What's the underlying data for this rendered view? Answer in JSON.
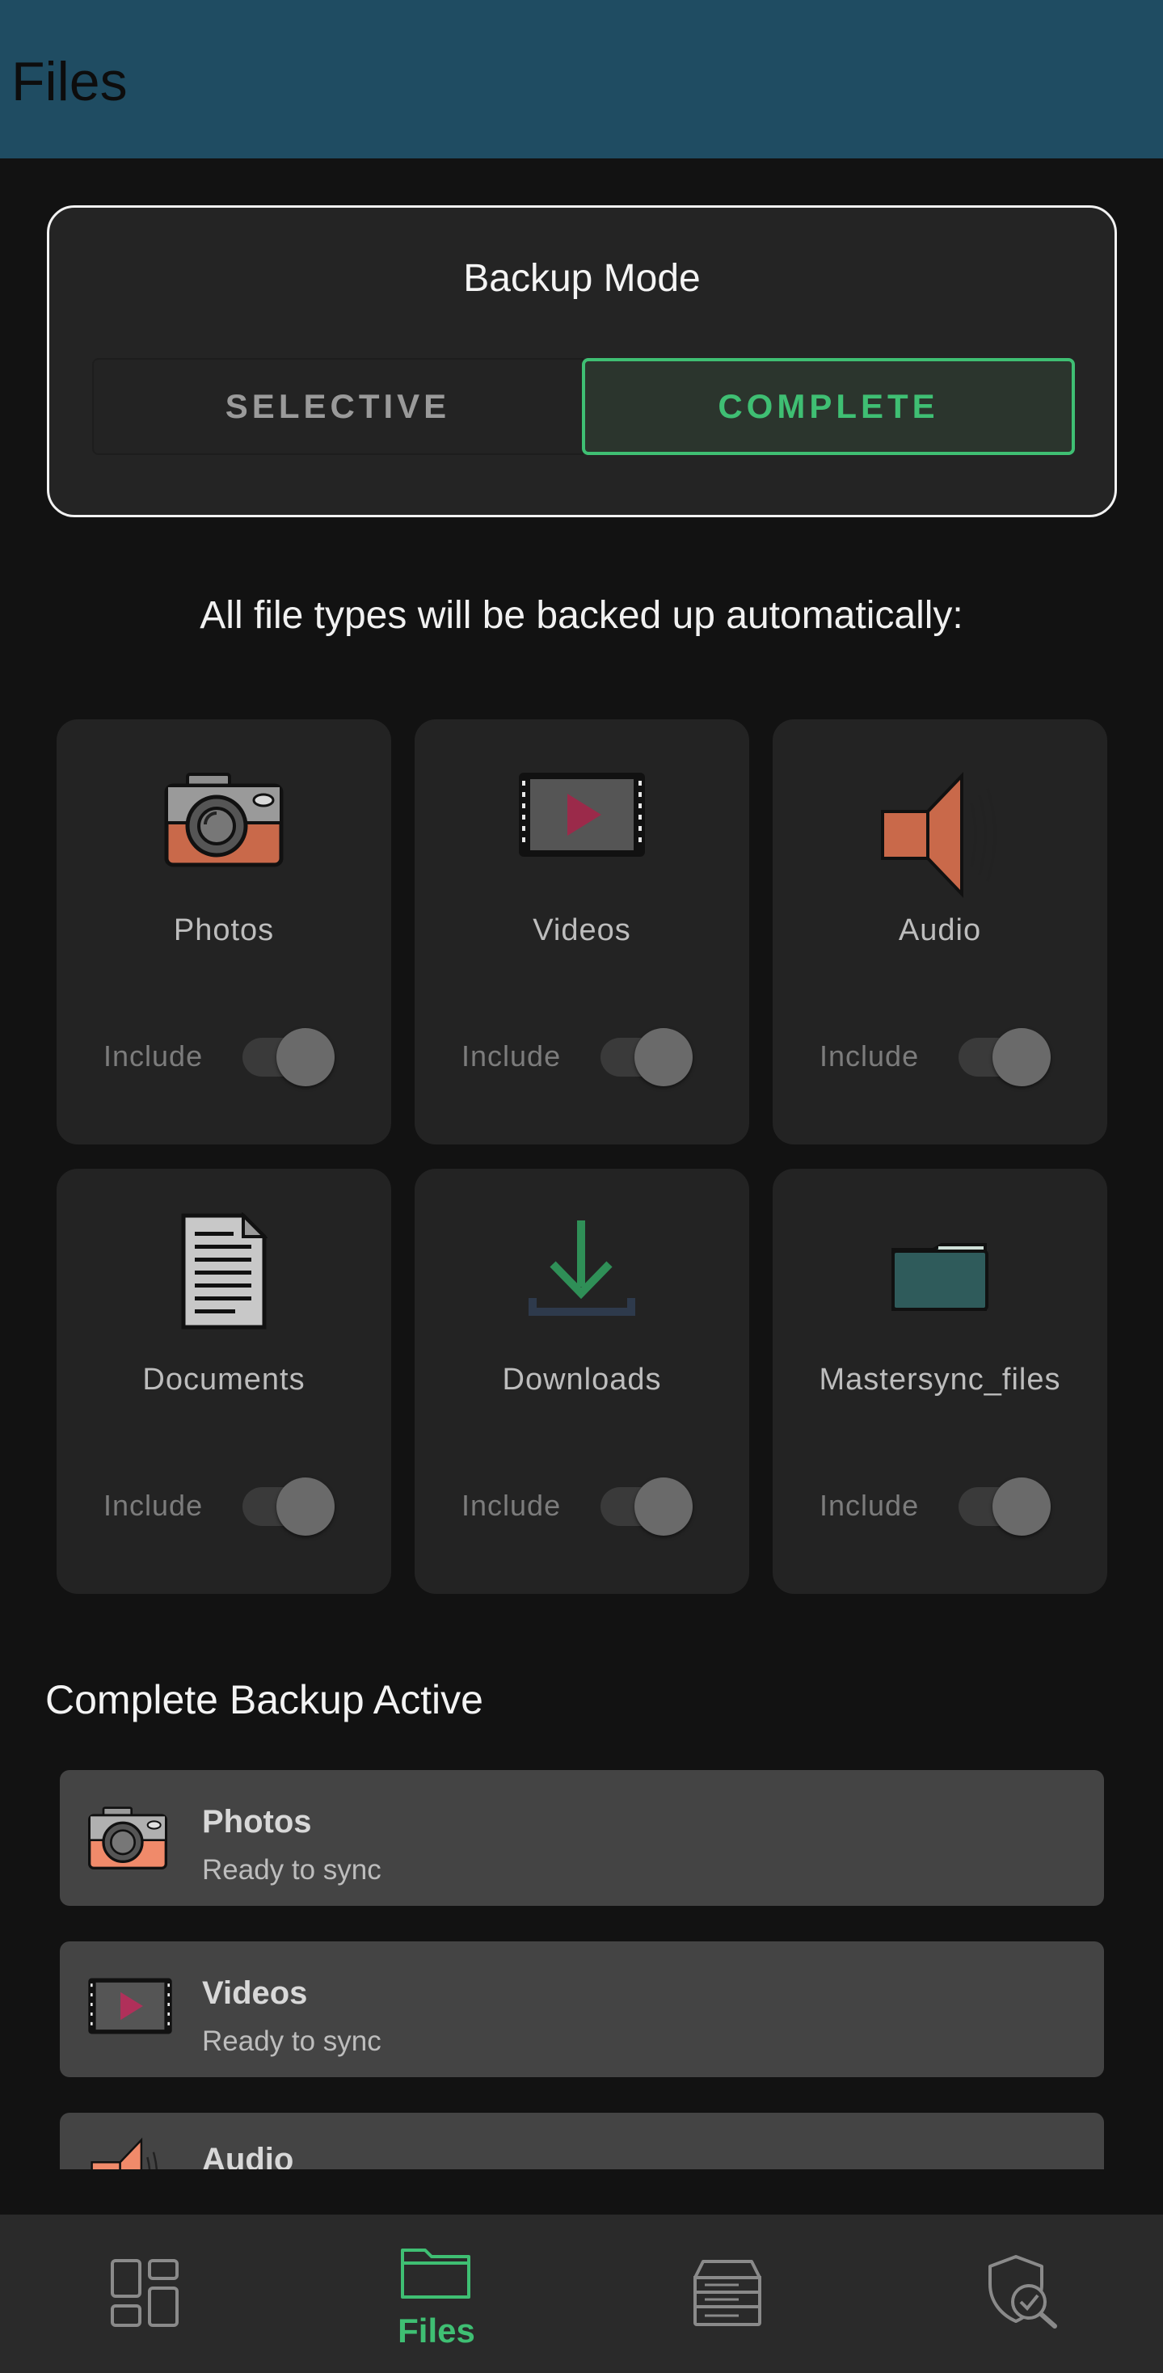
{
  "appbar": {
    "title": "Files",
    "color": "#1f4c62"
  },
  "backup_mode": {
    "title": "Backup Mode",
    "options": [
      {
        "label": "SELECTIVE",
        "selected": false
      },
      {
        "label": "COMPLETE",
        "selected": true
      }
    ],
    "accent": "#3fbf73"
  },
  "info_text": "All file types will be backed up automatically:",
  "file_types": [
    {
      "label": "Photos",
      "icon": "camera-icon",
      "toggle_label": "Include",
      "included": false
    },
    {
      "label": "Videos",
      "icon": "film-play-icon",
      "toggle_label": "Include",
      "included": false
    },
    {
      "label": "Audio",
      "icon": "speaker-icon",
      "toggle_label": "Include",
      "included": false
    },
    {
      "label": "Documents",
      "icon": "document-icon",
      "toggle_label": "Include",
      "included": false
    },
    {
      "label": "Downloads",
      "icon": "download-icon",
      "toggle_label": "Include",
      "included": false
    },
    {
      "label": "Mastersync_files",
      "icon": "folder-icon",
      "toggle_label": "Include",
      "included": false
    }
  ],
  "active_section": {
    "title": "Complete Backup Active",
    "items": [
      {
        "name": "Photos",
        "status": "Ready to sync",
        "icon": "camera-icon"
      },
      {
        "name": "Videos",
        "status": "Ready to sync",
        "icon": "film-play-icon"
      },
      {
        "name": "Audio",
        "status": "",
        "icon": "speaker-icon"
      }
    ]
  },
  "bottom_nav": {
    "items": [
      {
        "label": "",
        "icon": "dashboard-icon",
        "active": false
      },
      {
        "label": "Files",
        "icon": "folder-icon",
        "active": true
      },
      {
        "label": "",
        "icon": "server-icon",
        "active": false
      },
      {
        "label": "",
        "icon": "shield-check-icon",
        "active": false
      }
    ],
    "active_color": "#3fbf73"
  }
}
